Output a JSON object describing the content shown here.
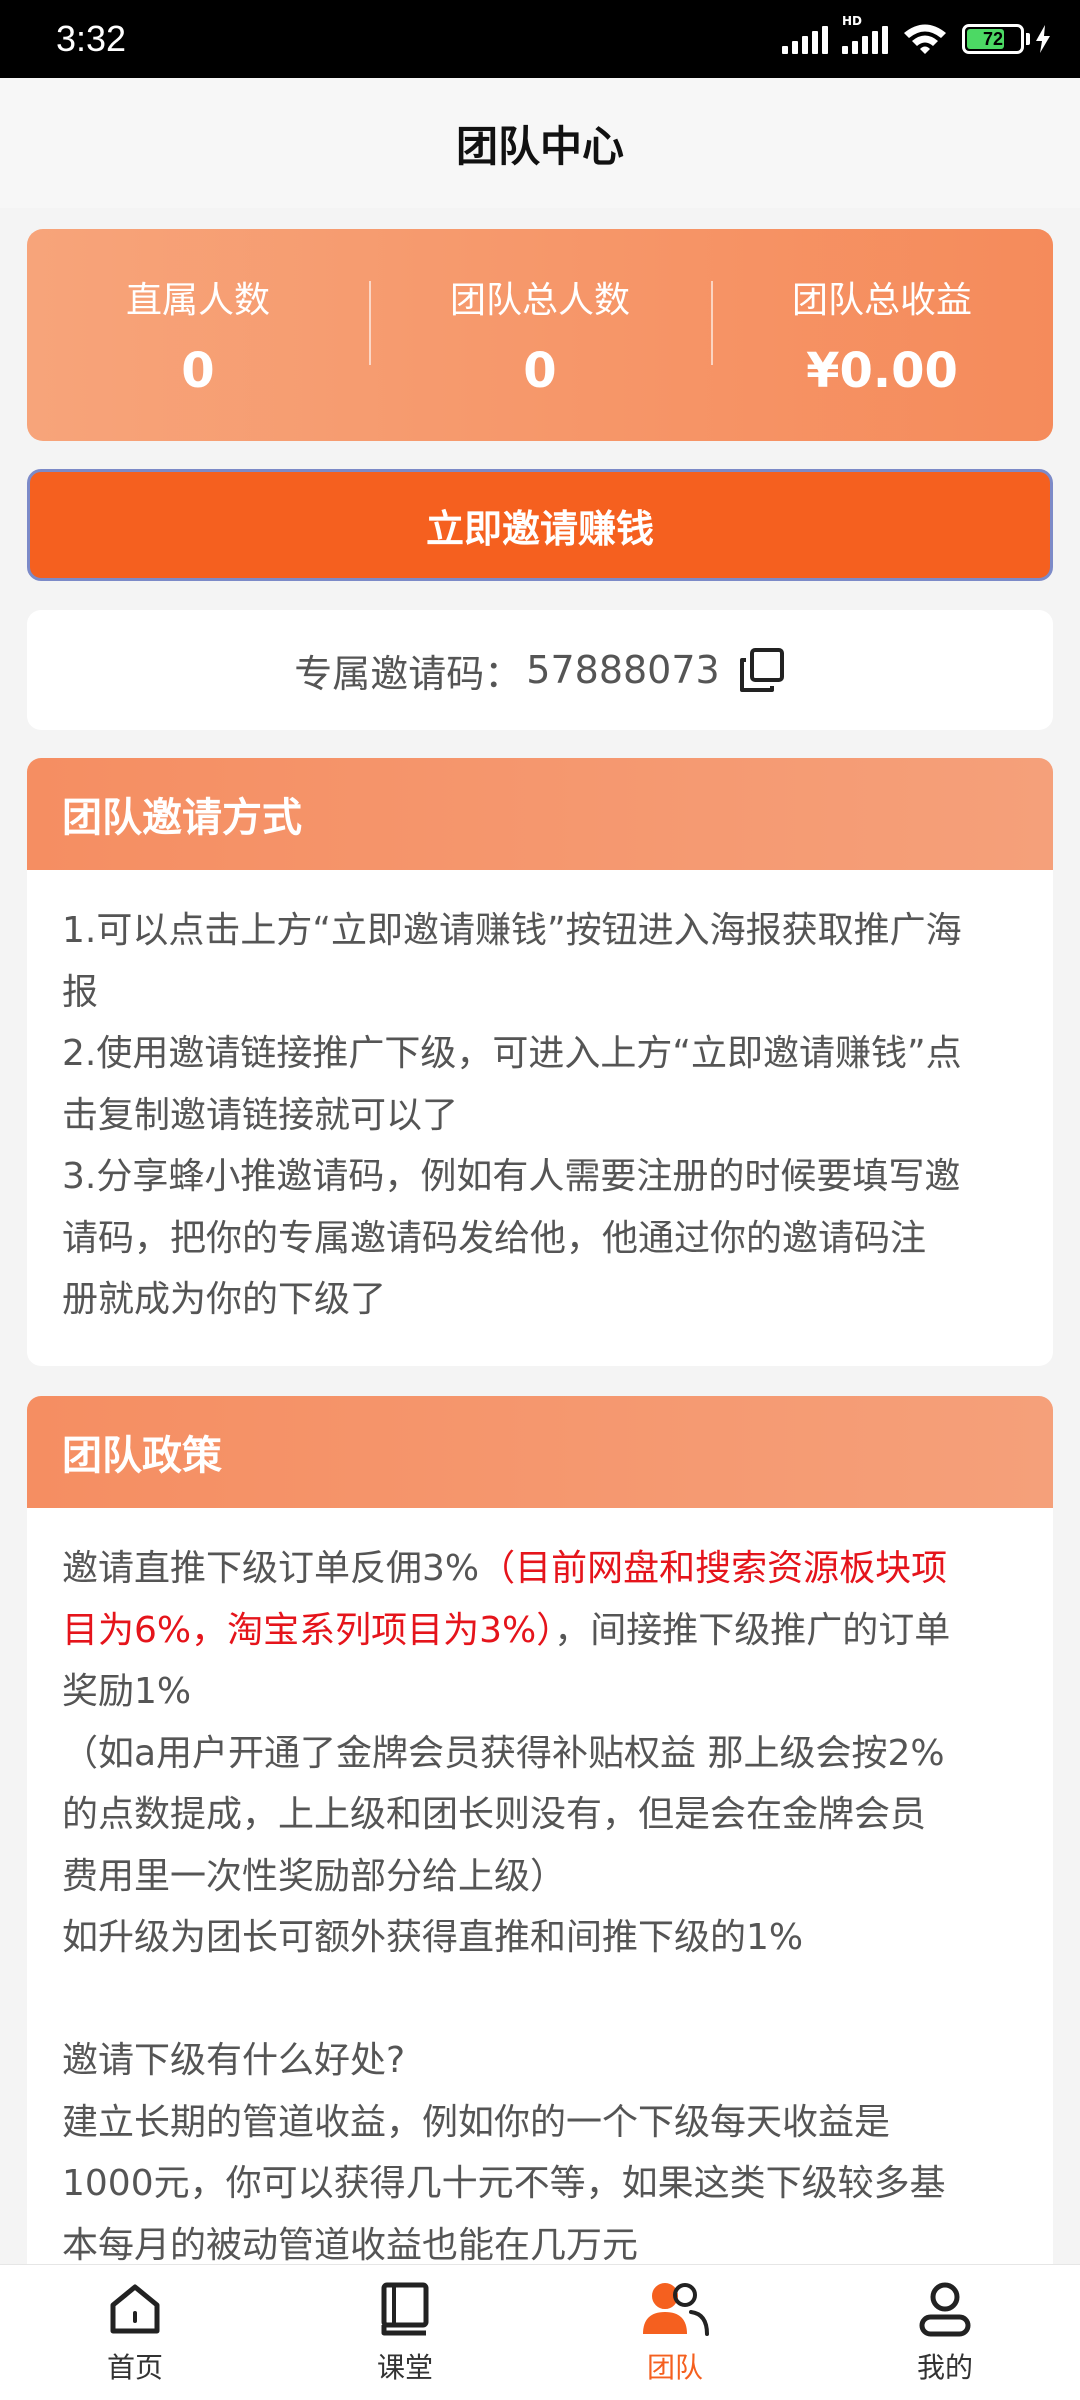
{
  "status_bar": {
    "time": "3:32",
    "hd_label": "HD",
    "battery": "72",
    "battery_level": 0.72
  },
  "header": {
    "title": "团队中心"
  },
  "stats": [
    {
      "label": "直属人数",
      "value": "0"
    },
    {
      "label": "团队总人数",
      "value": "0"
    },
    {
      "label": "团队总收益",
      "value": "¥0.00"
    }
  ],
  "invite_button": {
    "label": "立即邀请赚钱"
  },
  "invite_code": {
    "label": "专属邀请码：",
    "value": "57888073",
    "copy_icon": "copy-icon"
  },
  "section_methods": {
    "title": "团队邀请方式",
    "lines": [
      "1.可以点击上方“立即邀请赚钱”按钮进入海报获取推广海",
      "报",
      "2.使用邀请链接推广下级，可进入上方“立即邀请赚钱”点",
      "击复制邀请链接就可以了",
      "3.分享蜂小推邀请码，例如有人需要注册的时候要填写邀",
      "请码，把你的专属邀请码发给他，他通过你的邀请码注",
      "册就成为你的下级了"
    ]
  },
  "section_policy": {
    "title": "团队政策",
    "line1_a": "邀请直推下级订单反佣3%",
    "line1_b": "（目前网盘和搜索资源板块项",
    "line2_a": "目为6%，淘宝系列项目为3%）",
    "line2_b": "，间接推下级推广的订单",
    "lines_rest_1": [
      "奖励1%",
      "（如a用户开通了金牌会员获得补贴权益 那上级会按2%",
      "的点数提成，上上级和团长则没有，但是会在金牌会员",
      "费用里一次性奖励部分给上级）",
      "如升级为团长可额外获得直推和间推下级的1%"
    ],
    "lines_rest_2": [
      "邀请下级有什么好处?",
      "建立长期的管道收益，例如你的一个下级每天收益是",
      "1000元，你可以获得几十元不等，如果这类下级较多基",
      "本每月的被动管道收益也能在几万元"
    ],
    "highlight_color": "#e5141b"
  },
  "bottom_nav": [
    {
      "label": "首页",
      "icon": "home-icon"
    },
    {
      "label": "课堂",
      "icon": "book-icon"
    },
    {
      "label": "团队",
      "icon": "team-icon",
      "active": true
    },
    {
      "label": "我的",
      "icon": "user-icon"
    }
  ],
  "colors": {
    "accent": "#f5601f",
    "card_gradient_start": "#f7a47a",
    "card_gradient_end": "#f58b5b"
  }
}
